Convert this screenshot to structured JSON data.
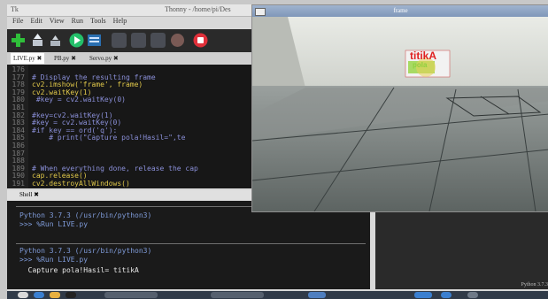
{
  "thonny": {
    "app_icon": "Tk",
    "title": "Thonny  -  /home/pi/Des",
    "menu": [
      "File",
      "Edit",
      "View",
      "Run",
      "Tools",
      "Help"
    ],
    "tabs": [
      "LIVE.py",
      "PB.py",
      "Servo.py"
    ],
    "tab_close": "✖"
  },
  "editor": {
    "lines": [
      {
        "n": "176",
        "code": "",
        "type": "code"
      },
      {
        "n": "177",
        "code": "# Display the resulting frame",
        "type": "comment"
      },
      {
        "n": "178",
        "code": "cv2.imshow('frame', frame)",
        "type": "code"
      },
      {
        "n": "179",
        "code": "cv2.waitKey(1)",
        "type": "code"
      },
      {
        "n": "180",
        "code": " #key = cv2.waitKey(0)",
        "type": "comment"
      },
      {
        "n": "181",
        "code": "",
        "type": "code"
      },
      {
        "n": "182",
        "code": "#key=cv2.waitKey(1)",
        "type": "comment"
      },
      {
        "n": "183",
        "code": "#key = cv2.waitKey(0)",
        "type": "comment"
      },
      {
        "n": "184",
        "code": "#if key == ord('q'):",
        "type": "comment"
      },
      {
        "n": "185",
        "code": "    # print(\"Capture pola!Hasil=\",te",
        "type": "comment"
      },
      {
        "n": "186",
        "code": "",
        "type": "code"
      },
      {
        "n": "187",
        "code": "",
        "type": "code"
      },
      {
        "n": "188",
        "code": "",
        "type": "code"
      },
      {
        "n": "189",
        "code": "# When everything done, release the cap",
        "type": "comment"
      },
      {
        "n": "190",
        "code": "cap.release()",
        "type": "code"
      },
      {
        "n": "191",
        "code": "cv2.destroyAllWindows()",
        "type": "code"
      }
    ]
  },
  "shell": {
    "tab_label": "Shell",
    "lines": [
      {
        "text": "Python 3.7.3 (/usr/bin/python3)",
        "type": "info"
      },
      {
        "text": ">>> %Run LIVE.py",
        "type": "info"
      },
      {
        "text": "Python 3.7.3 (/usr/bin/python3)",
        "type": "info"
      },
      {
        "text": ">>> %Run LIVE.py",
        "type": "info"
      },
      {
        "text": "  Capture pola!Hasil= titikA",
        "type": "out"
      }
    ]
  },
  "status": {
    "python_version": "Python 3.7.3"
  },
  "frame": {
    "title": "frame",
    "detection_label": "titikA",
    "detection_sub": "pola"
  },
  "colors": {
    "code_yellow": "#e0c84a",
    "comment_blue": "#8a8fd8",
    "detect_red": "#e02020"
  },
  "icons": [
    "new-file-icon",
    "open-icon",
    "save-icon",
    "run-icon",
    "debug-icon",
    "step-over-icon",
    "step-into-icon",
    "step-out-icon",
    "resume-icon",
    "stop-icon"
  ]
}
